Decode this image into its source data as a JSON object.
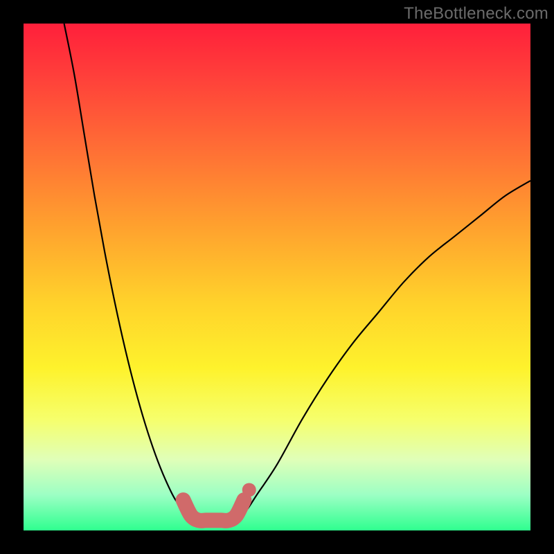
{
  "watermark": {
    "text": "TheBottleneck.com"
  },
  "chart_data": {
    "type": "line",
    "title": "",
    "xlabel": "",
    "ylabel": "",
    "xlim": [
      0,
      100
    ],
    "ylim": [
      0,
      100
    ],
    "grid": false,
    "legend": false,
    "background_gradient": {
      "top": "#ff1f3b",
      "bottom": "#2fff8f",
      "note": "red at top → green at bottom"
    },
    "series": [
      {
        "name": "left-branch",
        "style": "thin-black",
        "x": [
          8,
          10,
          12,
          14,
          16,
          18,
          20,
          22,
          24,
          26,
          28,
          30,
          32,
          33,
          34,
          35
        ],
        "y": [
          100,
          90,
          78,
          66,
          55,
          45,
          36,
          28,
          21,
          15,
          10,
          6,
          4,
          3,
          2,
          2
        ]
      },
      {
        "name": "right-branch",
        "style": "thin-black",
        "x": [
          42,
          44,
          46,
          50,
          55,
          60,
          65,
          70,
          75,
          80,
          85,
          90,
          95,
          100
        ],
        "y": [
          2,
          4,
          7,
          13,
          22,
          30,
          37,
          43,
          49,
          54,
          58,
          62,
          66,
          69
        ]
      },
      {
        "name": "valley-highlight",
        "style": "thick-salmon",
        "x": [
          31.5,
          33,
          34.5,
          36,
          37.5,
          39,
          40.5,
          42,
          43.5
        ],
        "y": [
          6,
          3,
          2,
          2,
          2,
          2,
          2,
          3,
          6
        ]
      },
      {
        "name": "valley-end-dot",
        "style": "salmon-dot",
        "x": [
          44.5
        ],
        "y": [
          8
        ]
      }
    ],
    "annotations": []
  },
  "colors": {
    "curve_thin": "#000000",
    "curve_thick": "#d06a6a",
    "frame": "#000000"
  }
}
